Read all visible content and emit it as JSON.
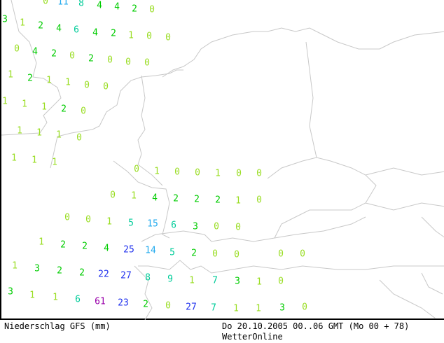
{
  "footer": {
    "title": "Niederschlag GFS (mm)",
    "valid_time": "Do 20.10.2005 00..06 GMT (Mo 00 + 78)",
    "provider": "WetterOnline"
  },
  "color_scale": {
    "0-1": "#99dd22",
    "2-4": "#00cc00",
    "5-9": "#00cc99",
    "10-19": "#22aaee",
    "20-49": "#2233ee",
    "50+": "#9900aa"
  },
  "precipitation_values": [
    "0",
    "11",
    "8",
    "4",
    "4",
    "2",
    "0",
    "3",
    "1",
    "2",
    "4",
    "6",
    "4",
    "2",
    "1",
    "0",
    "0",
    "0",
    "4",
    "2",
    "0",
    "2",
    "0",
    "0",
    "0",
    "1",
    "2",
    "1",
    "1",
    "0",
    "0",
    "1",
    "1",
    "1",
    "2",
    "0",
    "1",
    "1",
    "1",
    "0",
    "1",
    "1",
    "1",
    "0",
    "1",
    "0",
    "0",
    "1",
    "0",
    "0",
    "0",
    "1",
    "4",
    "2",
    "2",
    "2",
    "1",
    "0",
    "0",
    "0",
    "1",
    "5",
    "15",
    "6",
    "3",
    "0",
    "0",
    "1",
    "2",
    "2",
    "4",
    "25",
    "14",
    "5",
    "2",
    "0",
    "0",
    "0",
    "0",
    "1",
    "3",
    "2",
    "2",
    "22",
    "27",
    "8",
    "9",
    "1",
    "7",
    "3",
    "1",
    "0",
    "3",
    "1",
    "1",
    "6",
    "61",
    "23",
    "2",
    "0",
    "27",
    "7",
    "1",
    "1",
    "3",
    "0"
  ]
}
